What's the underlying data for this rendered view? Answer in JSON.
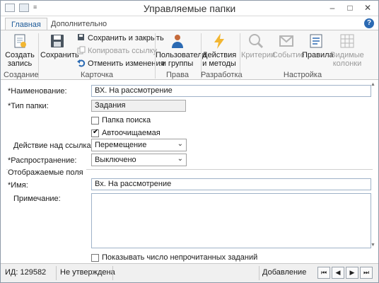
{
  "window": {
    "title": "Управляемые папки"
  },
  "tabs": [
    {
      "label": "Главная"
    },
    {
      "label": "Дополнительно"
    }
  ],
  "help_label": "?",
  "ribbon": {
    "create_label": "Создать\nзапись",
    "save_label": "Сохранить",
    "save_close_label": "Сохранить и закрыть",
    "copy_link_label": "Копировать ссылку",
    "undo_label": "Отменить изменения",
    "users_groups_label": "Пользователи\nи группы",
    "actions_methods_label": "Действия\nи методы",
    "criteria_label": "Критерии",
    "event_label": "Событие",
    "rules_label": "Правила",
    "visible_columns_label": "Видимые\nколонки",
    "groups": {
      "creation": "Создание",
      "card": "Карточка",
      "access": "Права доступа",
      "development": "Разработка",
      "settings": "Настройка"
    }
  },
  "form": {
    "name_label": "*Наименование:",
    "name_value": "ВХ. На рассмотрение",
    "folder_type_label": "*Тип папки:",
    "folder_type_value": "Задания",
    "search_folder_label": "Папка поиска",
    "search_folder_checked": false,
    "autoclean_label": "Автоочищаемая",
    "autoclean_checked": true,
    "link_action_label": "Действие над ссылками:",
    "link_action_value": "Перемещение",
    "distribution_label": "*Распространение:",
    "distribution_value": "Выключено",
    "displayed_fields_label": "Отображаемые поля",
    "display_name_label": "*Имя:",
    "display_name_value": "Вх. На рассмотрение",
    "note_label": "Примечание:",
    "note_value": "",
    "show_unread_label": "Показывать число непрочитанных заданий",
    "show_unread_checked": false
  },
  "status": {
    "id_text": "ИД: 129582",
    "approval_text": "Не утверждена",
    "mode_text": "Добавление",
    "nav": [
      "⏮",
      "◀",
      "▶",
      "⏭"
    ]
  }
}
